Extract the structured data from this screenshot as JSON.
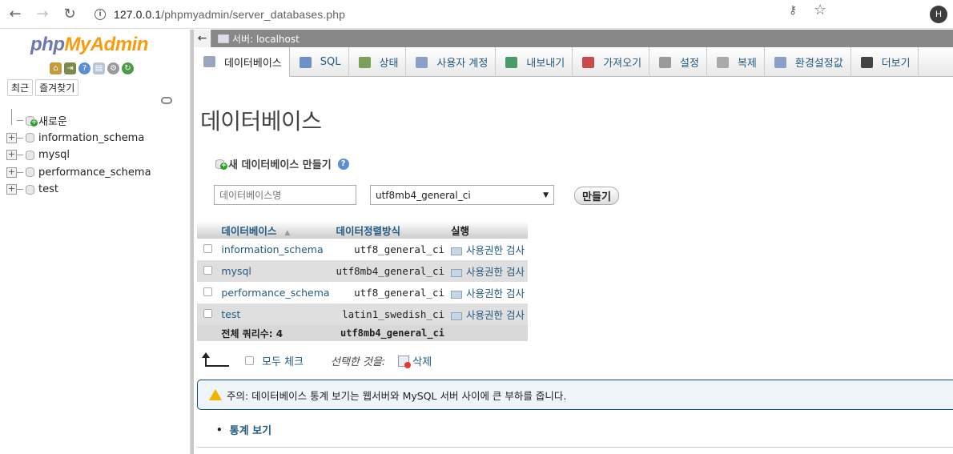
{
  "browser": {
    "url_host": "127.0.0.1",
    "url_path": "/phpmyadmin/server_databases.php",
    "profile_initial": "H"
  },
  "sidebar": {
    "logo_php": "php",
    "logo_myadmin": "MyAdmin",
    "tabs": [
      "최근",
      "즐겨찾기"
    ],
    "tree": [
      {
        "label": "새로운",
        "kind": "new"
      },
      {
        "label": "information_schema",
        "kind": "db"
      },
      {
        "label": "mysql",
        "kind": "db"
      },
      {
        "label": "performance_schema",
        "kind": "db"
      },
      {
        "label": "test",
        "kind": "db"
      }
    ]
  },
  "header": {
    "server_label": "서버: localhost"
  },
  "nav_tabs": [
    {
      "label": "데이터베이스",
      "active": true,
      "icon_color": "#9aa6c0"
    },
    {
      "label": "SQL",
      "active": false,
      "icon_color": "#6f8fc8"
    },
    {
      "label": "상태",
      "active": false,
      "icon_color": "#7aa05a"
    },
    {
      "label": "사용자 계정",
      "active": false,
      "icon_color": "#8aa0c8"
    },
    {
      "label": "내보내기",
      "active": false,
      "icon_color": "#4a9a6a"
    },
    {
      "label": "가져오기",
      "active": false,
      "icon_color": "#c84a4a"
    },
    {
      "label": "설정",
      "active": false,
      "icon_color": "#9a9a9a"
    },
    {
      "label": "복제",
      "active": false,
      "icon_color": "#aaaaaa"
    },
    {
      "label": "환경설정값",
      "active": false,
      "icon_color": "#8aa0c8"
    },
    {
      "label": "더보기",
      "active": false,
      "icon_color": "#444444"
    }
  ],
  "main": {
    "title": "데이터베이스",
    "create_label": "새 데이터베이스 만들기",
    "db_name_placeholder": "데이터베이스명",
    "collation_selected": "utf8mb4_general_ci",
    "create_button": "만들기",
    "table": {
      "headers": [
        "데이터베이스",
        "데이터정렬방식",
        "실행"
      ],
      "rows": [
        {
          "name": "information_schema",
          "collation": "utf8_general_ci",
          "action": "사용권한 검사"
        },
        {
          "name": "mysql",
          "collation": "utf8mb4_general_ci",
          "action": "사용권한 검사"
        },
        {
          "name": "performance_schema",
          "collation": "utf8_general_ci",
          "action": "사용권한 검사"
        },
        {
          "name": "test",
          "collation": "latin1_swedish_ci",
          "action": "사용권한 검사"
        }
      ],
      "footer_total": "전체 쿼리수: 4",
      "footer_collation": "utf8mb4_general_ci"
    },
    "check_all": "모두 체크",
    "with_selected": "선택한 것을:",
    "delete": "삭제",
    "notice": "주의: 데이터베이스 통계 보기는 웹서버와 MySQL 서버 사이에 큰 부하를 줍니다.",
    "stats_link": "통계 보기"
  }
}
